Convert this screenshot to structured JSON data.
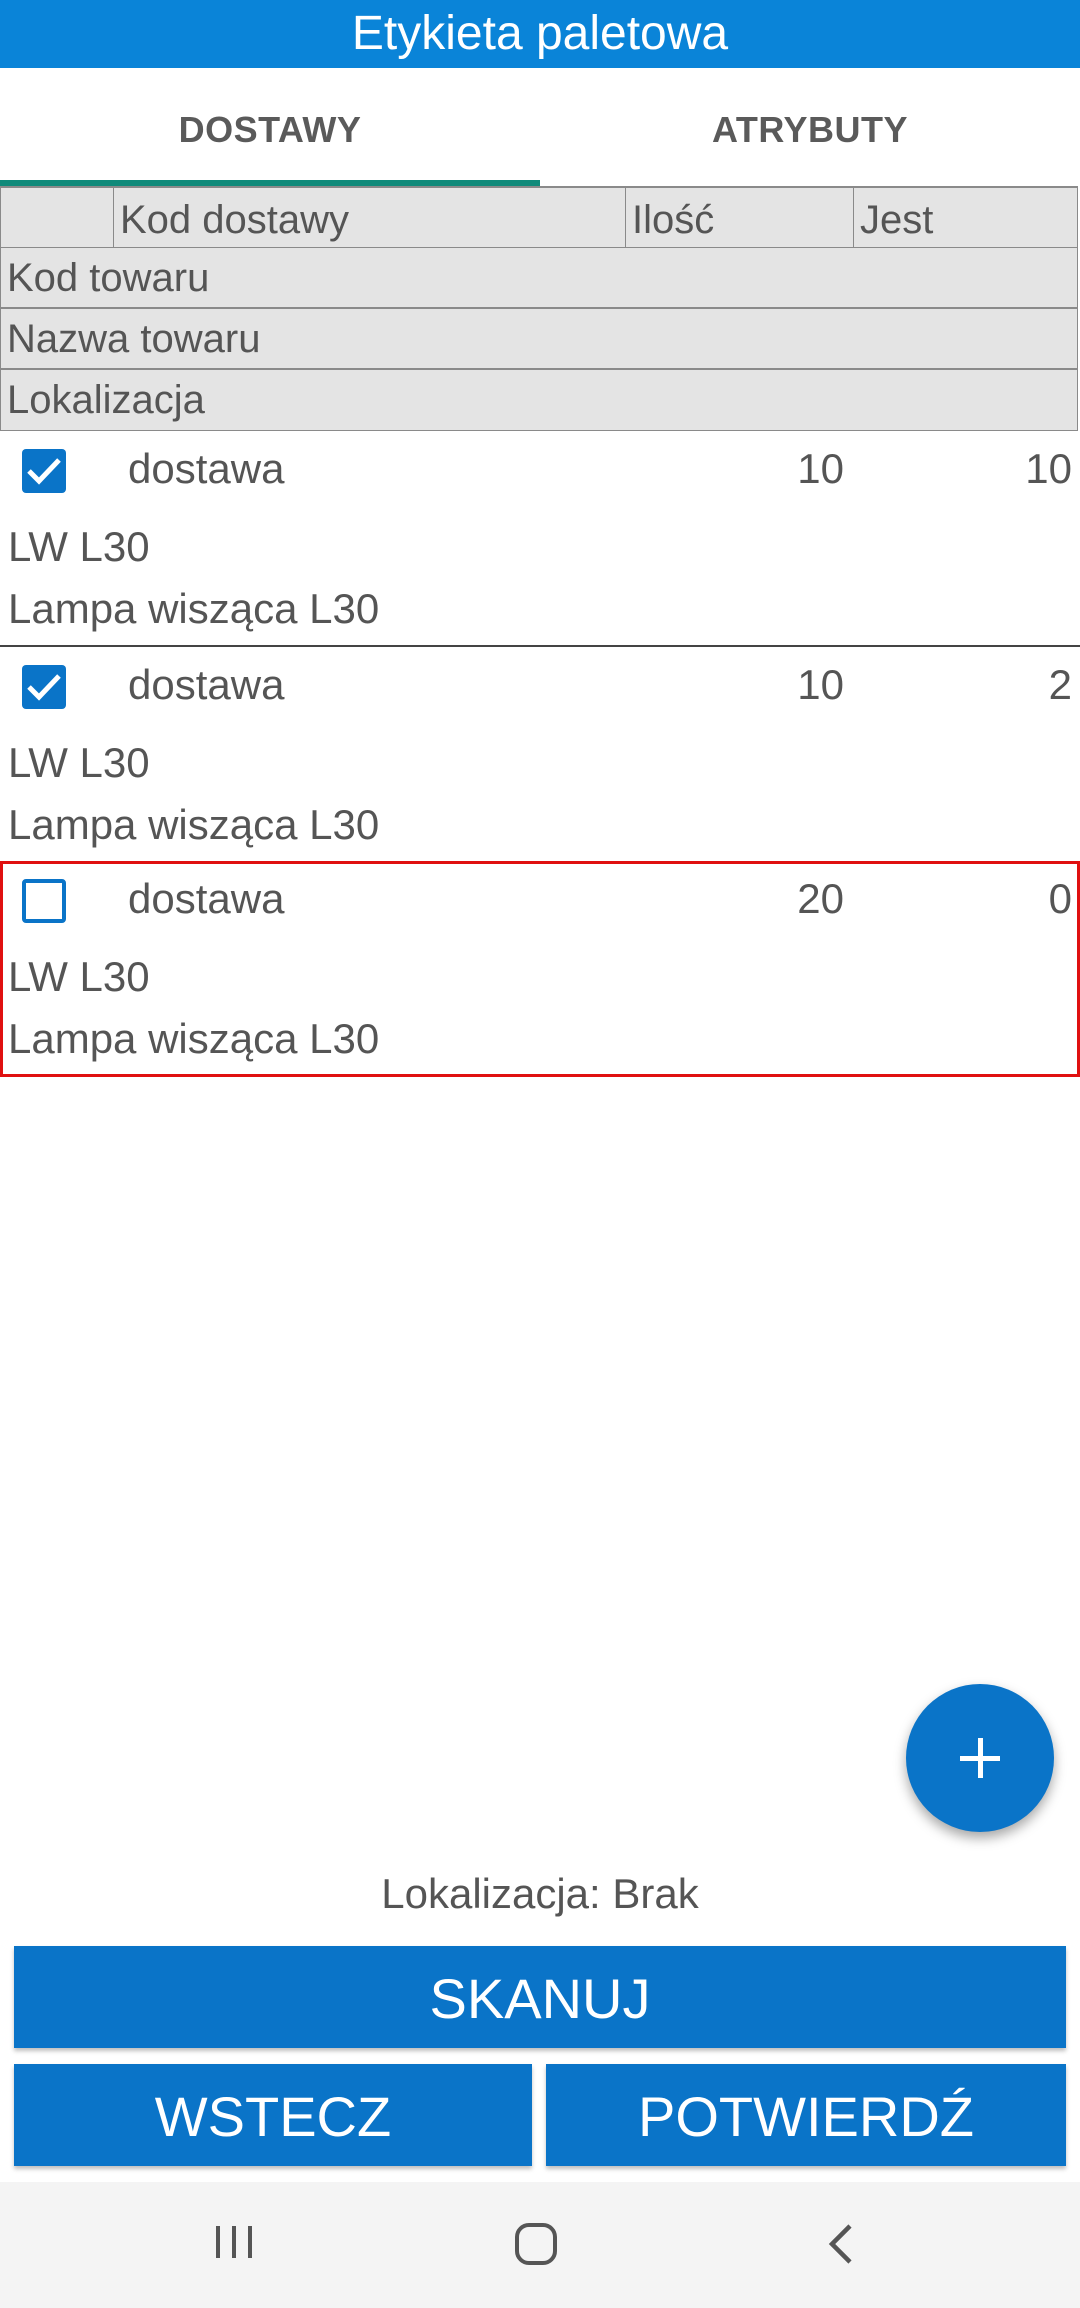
{
  "title": "Etykieta paletowa",
  "tabs": [
    {
      "label": "DOSTAWY",
      "active": true
    },
    {
      "label": "ATRYBUTY",
      "active": false
    }
  ],
  "header": {
    "col_delivery_code": "Kod dostawy",
    "col_quantity": "Ilość",
    "col_present": "Jest",
    "row_product_code": "Kod towaru",
    "row_product_name": "Nazwa towaru",
    "row_location": "Lokalizacja"
  },
  "items": [
    {
      "checked": true,
      "delivery": "dostawa",
      "quantity": "10",
      "present": "10",
      "code": "LW L30",
      "name": "Lampa wisząca L30"
    },
    {
      "checked": true,
      "delivery": "dostawa",
      "quantity": "10",
      "present": "2",
      "code": "LW L30",
      "name": "Lampa wisząca L30"
    },
    {
      "checked": false,
      "delivery": "dostawa",
      "quantity": "20",
      "present": "0",
      "code": "LW L30",
      "name": "Lampa wisząca L30"
    }
  ],
  "fab_icon": "plus-icon",
  "location_status": "Lokalizacja: Brak",
  "buttons": {
    "scan": "SKANUJ",
    "back": "WSTECZ",
    "confirm": "POTWIERDŹ"
  },
  "navbar_icons": [
    "recent-apps-icon",
    "home-icon",
    "back-icon"
  ],
  "colors": {
    "primary": "#0a74c8",
    "title_bar": "#0a84d8",
    "tab_indicator": "#0f8a7a",
    "highlight": "#e01010",
    "header_bg": "#e4e4e4"
  }
}
